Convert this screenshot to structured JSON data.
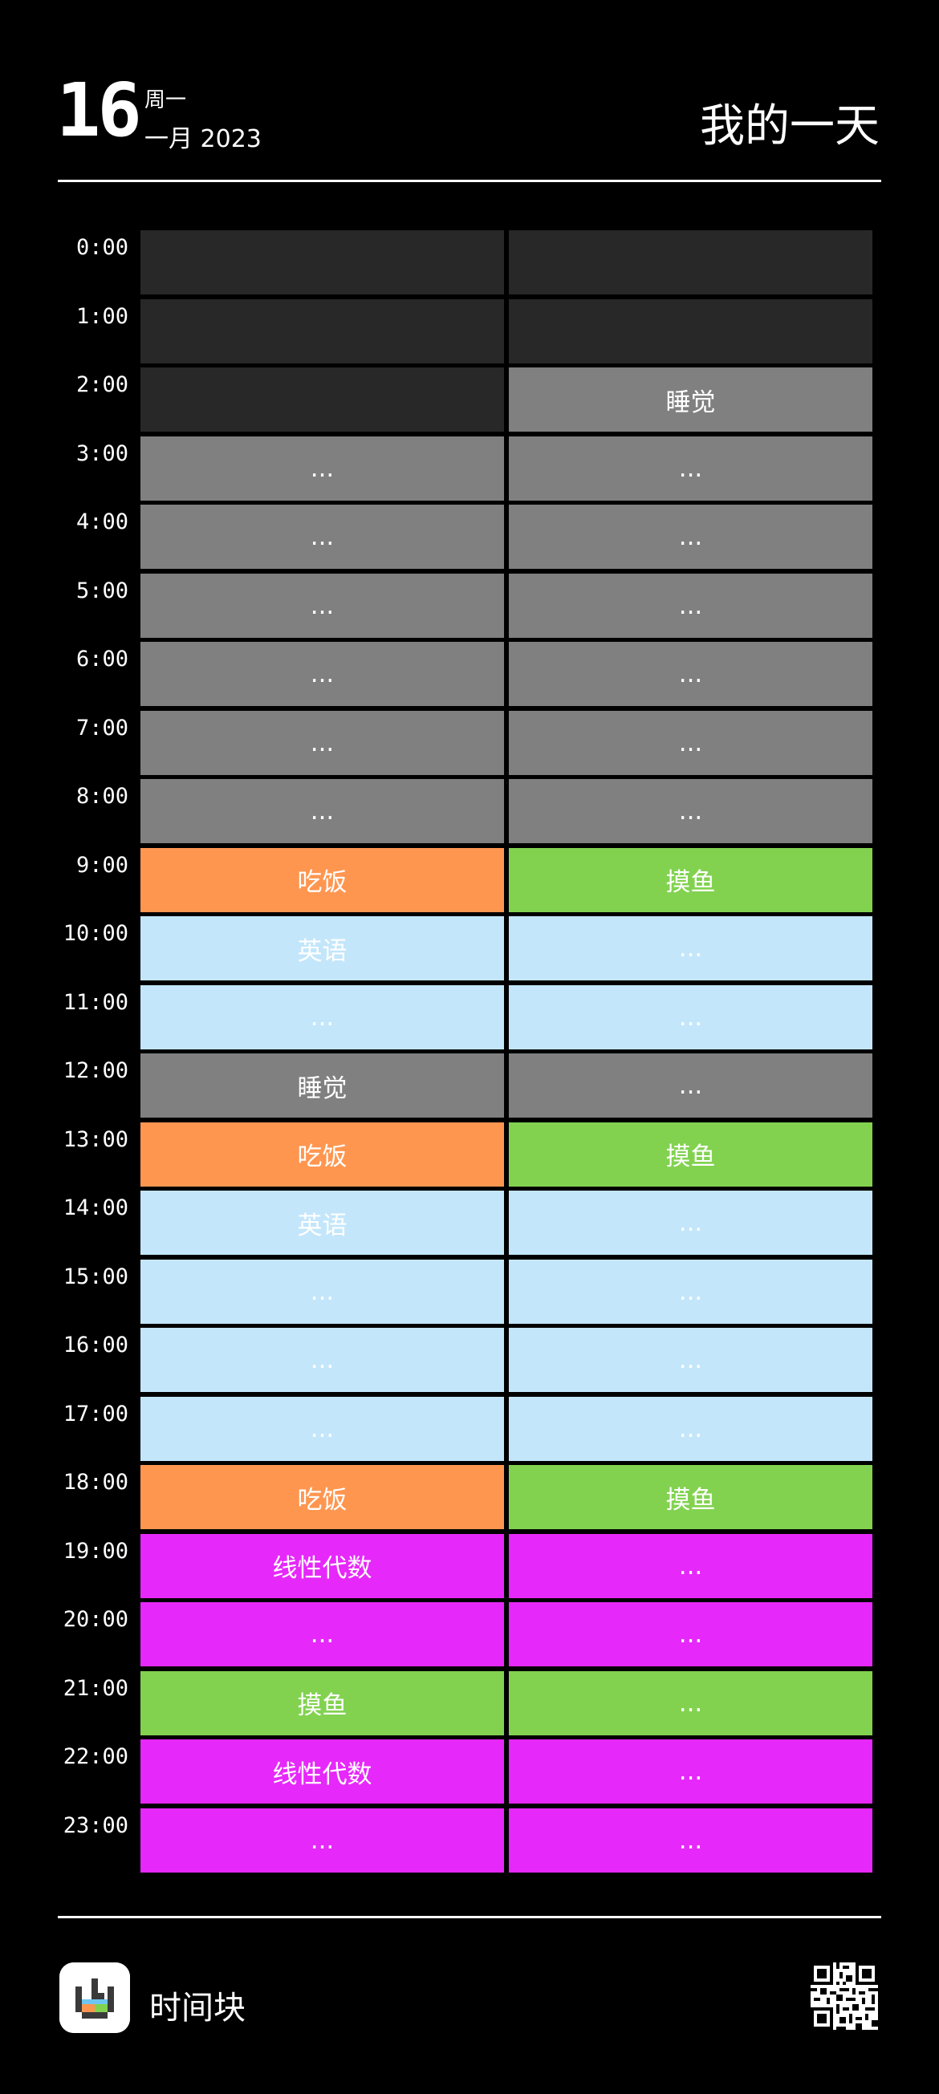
{
  "header": {
    "day": "16",
    "weekday": "周一",
    "month_year": "一月 2023",
    "title": "我的一天"
  },
  "colors": {
    "empty": "#282828",
    "sleep": "#808080",
    "eat": "#ff9650",
    "slack": "#82d250",
    "english": "#c3e6fa",
    "math": "#e628fa"
  },
  "schedule": [
    {
      "time": "0:00",
      "cells": [
        {
          "label": "",
          "cat": "empty"
        },
        {
          "label": "",
          "cat": "empty"
        }
      ]
    },
    {
      "time": "1:00",
      "cells": [
        {
          "label": "",
          "cat": "empty"
        },
        {
          "label": "",
          "cat": "empty"
        }
      ]
    },
    {
      "time": "2:00",
      "cells": [
        {
          "label": "",
          "cat": "empty"
        },
        {
          "label": "睡觉",
          "cat": "sleep"
        }
      ]
    },
    {
      "time": "3:00",
      "cells": [
        {
          "label": "...",
          "cat": "sleep"
        },
        {
          "label": "...",
          "cat": "sleep"
        }
      ]
    },
    {
      "time": "4:00",
      "cells": [
        {
          "label": "...",
          "cat": "sleep"
        },
        {
          "label": "...",
          "cat": "sleep"
        }
      ]
    },
    {
      "time": "5:00",
      "cells": [
        {
          "label": "...",
          "cat": "sleep"
        },
        {
          "label": "...",
          "cat": "sleep"
        }
      ]
    },
    {
      "time": "6:00",
      "cells": [
        {
          "label": "...",
          "cat": "sleep"
        },
        {
          "label": "...",
          "cat": "sleep"
        }
      ]
    },
    {
      "time": "7:00",
      "cells": [
        {
          "label": "...",
          "cat": "sleep"
        },
        {
          "label": "...",
          "cat": "sleep"
        }
      ]
    },
    {
      "time": "8:00",
      "cells": [
        {
          "label": "...",
          "cat": "sleep"
        },
        {
          "label": "...",
          "cat": "sleep"
        }
      ]
    },
    {
      "time": "9:00",
      "cells": [
        {
          "label": "吃饭",
          "cat": "eat"
        },
        {
          "label": "摸鱼",
          "cat": "slack"
        }
      ]
    },
    {
      "time": "10:00",
      "cells": [
        {
          "label": "英语",
          "cat": "english"
        },
        {
          "label": "...",
          "cat": "english"
        }
      ]
    },
    {
      "time": "11:00",
      "cells": [
        {
          "label": "...",
          "cat": "english"
        },
        {
          "label": "...",
          "cat": "english"
        }
      ]
    },
    {
      "time": "12:00",
      "cells": [
        {
          "label": "睡觉",
          "cat": "sleep"
        },
        {
          "label": "...",
          "cat": "sleep"
        }
      ]
    },
    {
      "time": "13:00",
      "cells": [
        {
          "label": "吃饭",
          "cat": "eat"
        },
        {
          "label": "摸鱼",
          "cat": "slack"
        }
      ]
    },
    {
      "time": "14:00",
      "cells": [
        {
          "label": "英语",
          "cat": "english"
        },
        {
          "label": "...",
          "cat": "english"
        }
      ]
    },
    {
      "time": "15:00",
      "cells": [
        {
          "label": "...",
          "cat": "english"
        },
        {
          "label": "...",
          "cat": "english"
        }
      ]
    },
    {
      "time": "16:00",
      "cells": [
        {
          "label": "...",
          "cat": "english"
        },
        {
          "label": "...",
          "cat": "english"
        }
      ]
    },
    {
      "time": "17:00",
      "cells": [
        {
          "label": "...",
          "cat": "english"
        },
        {
          "label": "...",
          "cat": "english"
        }
      ]
    },
    {
      "time": "18:00",
      "cells": [
        {
          "label": "吃饭",
          "cat": "eat"
        },
        {
          "label": "摸鱼",
          "cat": "slack"
        }
      ]
    },
    {
      "time": "19:00",
      "cells": [
        {
          "label": "线性代数",
          "cat": "math"
        },
        {
          "label": "...",
          "cat": "math"
        }
      ]
    },
    {
      "time": "20:00",
      "cells": [
        {
          "label": "...",
          "cat": "math"
        },
        {
          "label": "...",
          "cat": "math"
        }
      ]
    },
    {
      "time": "21:00",
      "cells": [
        {
          "label": "摸鱼",
          "cat": "slack"
        },
        {
          "label": "...",
          "cat": "slack"
        }
      ]
    },
    {
      "time": "22:00",
      "cells": [
        {
          "label": "线性代数",
          "cat": "math"
        },
        {
          "label": "...",
          "cat": "math"
        }
      ]
    },
    {
      "time": "23:00",
      "cells": [
        {
          "label": "...",
          "cat": "math"
        },
        {
          "label": "...",
          "cat": "math"
        }
      ]
    }
  ],
  "footer": {
    "app_name": "时间块",
    "logo_icon": "clock-blocks-icon",
    "qr_icon": "qr-code-icon"
  }
}
